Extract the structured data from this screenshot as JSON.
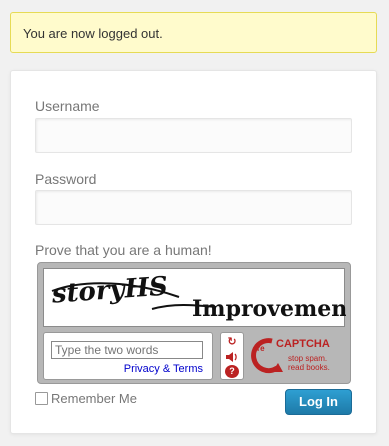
{
  "notice": {
    "message": "You are now logged out."
  },
  "form": {
    "username_label": "Username",
    "username_value": "",
    "password_label": "Password",
    "password_value": "",
    "captcha_label": "Prove that you are a human!",
    "remember_label": "Remember Me",
    "remember_checked": false,
    "login_label": "Log In"
  },
  "captcha": {
    "word1": "storyHS",
    "word2": "Improvement",
    "input_placeholder": "Type the two words",
    "privacy_link": "Privacy & Terms",
    "controls": [
      "refresh-icon",
      "audio-icon",
      "help-icon"
    ],
    "logo_text": "CAPTCHA",
    "logo_prefix": "re",
    "tagline1": "stop spam.",
    "tagline2": "read books."
  },
  "colors": {
    "notice_bg": "#fffbcc",
    "notice_border": "#e6db55",
    "button_blue": "#2e9fd2",
    "captcha_red": "#b22222"
  }
}
